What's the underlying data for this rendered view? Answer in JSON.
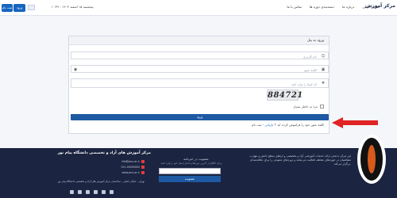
{
  "nav": {
    "register": "ثبت نام",
    "login": "ورود",
    "date": "پنجشنبه ۱۵ اسفند ۱۴۰۳ - ۱۰:۳۹",
    "menu": [
      "صفحه اصلی",
      "درباره ما",
      "دسته‌بندی دوره ها",
      "تماس با ما"
    ],
    "logo": "مرکز آموزش"
  },
  "login_card": {
    "title": "ورود به پنل",
    "username_placeholder": "نام کاربری",
    "password_placeholder": "کلمه عبور",
    "captcha_placeholder": "کد کپچا را وارد کنید",
    "captcha_code": "884721",
    "remember_label": "مرا به خاطر بسپار",
    "submit_label": "ورود",
    "forgot_prefix": "کلمه عبور خود را فراموش کرده اید ؟ ",
    "forgot_link": "بازیابی",
    "forgot_suffix": " - ثبت نام"
  },
  "footer": {
    "about": "این مرکز با هدف ارائه خدمات آموزشی آزاد و تخصصی و ارتقای سطح دانش و مهارت متقاضیان در حوزه‌های مختلف فعالیت می‌نماید و دوره‌های متنوعی را برای علاقه‌مندان برگزار می‌کند.",
    "newsletter_title": "عضویت در خبرنامه",
    "newsletter_text": "برای اطلاع از آخرین دوره‌ها و اخبار ایمیل خود را وارد کنید.",
    "newsletter_button": "عضویت",
    "center_title": "مرکز آموزش های آزاد و تخصصی دانشگاه پیام نور",
    "contacts": [
      "info@pnu.ac.ir",
      "021-00000000",
      "www.pnu.ac.ir"
    ],
    "address": "تهران - خیابان اصلی - ساختمان مرکز آموزش های آزاد و تخصصی دانشگاه پیام نور"
  },
  "colors": {
    "primary": "#1e5aa3",
    "footer_bg": "#1b2440",
    "arrow": "#e02424"
  }
}
